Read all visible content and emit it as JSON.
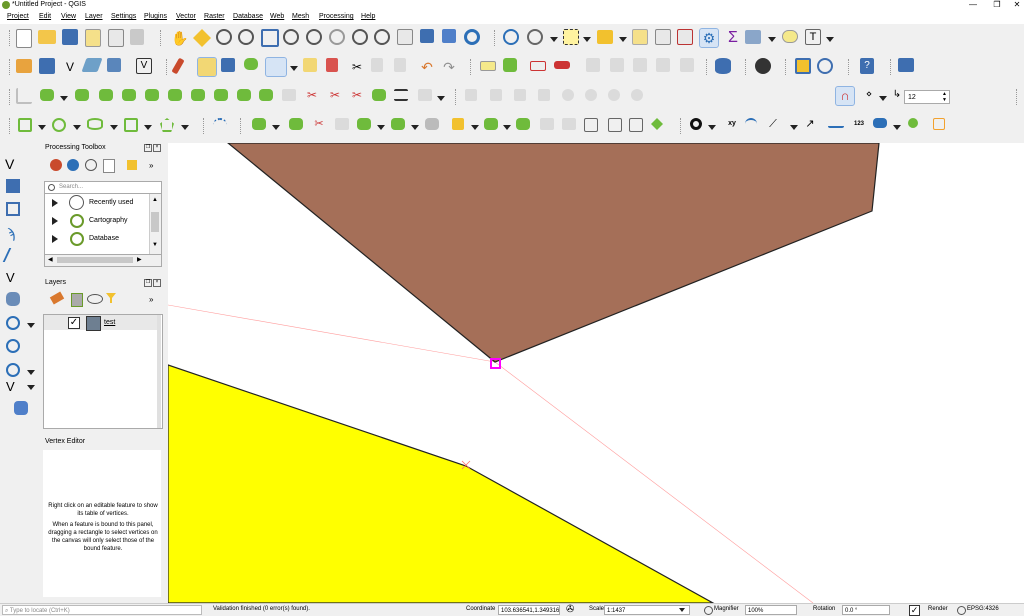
{
  "window": {
    "title": "*Untitled Project - QGIS",
    "controls": [
      "—",
      "❐",
      "✕"
    ]
  },
  "menu": [
    "Project",
    "Edit",
    "View",
    "Layer",
    "Settings",
    "Plugins",
    "Vector",
    "Raster",
    "Database",
    "Web",
    "Mesh",
    "Processing",
    "Help"
  ],
  "toolbar": {
    "snapping_tolerance": "12"
  },
  "processing_toolbox": {
    "title": "Processing Toolbox",
    "search_placeholder": "Search...",
    "items": [
      {
        "label": "Recently used",
        "icon": "clock-icon"
      },
      {
        "label": "Cartography",
        "icon": "qgis-icon"
      },
      {
        "label": "Database",
        "icon": "qgis-icon"
      }
    ]
  },
  "layers_panel": {
    "title": "Layers",
    "layers": [
      {
        "name": "test",
        "checked": true
      }
    ]
  },
  "vertex_editor": {
    "title": "Vertex Editor",
    "message1": "Right click on an editable feature to show its table of vertices.",
    "message2": "When a feature is bound to this panel, dragging a rectangle to select vertices on the canvas will only select those of the bound feature."
  },
  "statusbar": {
    "locator_placeholder": "Type to locate (Ctrl+K)",
    "message": "Validation finished (0 error(s) found).",
    "coordinate_label": "Coordinate",
    "coordinate_value": "103.636541,1.349316",
    "scale_label": "Scale",
    "scale_value": "1:1437",
    "magnifier_label": "Magnifier",
    "magnifier_value": "100%",
    "rotation_label": "Rotation",
    "rotation_value": "0.0 °",
    "render_label": "Render",
    "crs": "EPSG:4326"
  },
  "colors": {
    "brown_polygon": "#a56f58",
    "yellow_polygon": "#ffff00",
    "vertex_marker": "#ff00ff",
    "guide_line": "#ff9999"
  }
}
